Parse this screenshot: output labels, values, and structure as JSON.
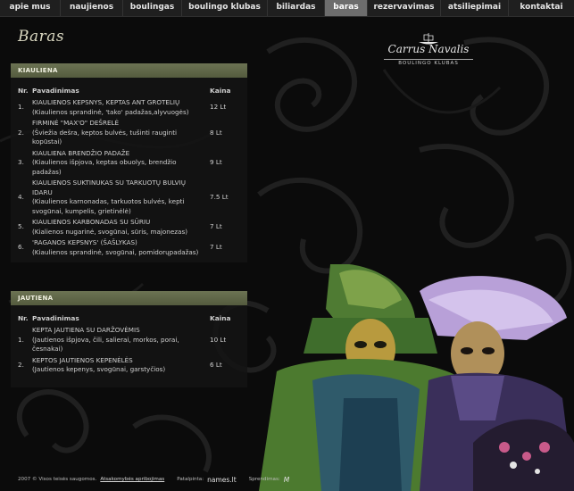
{
  "nav": {
    "items": [
      {
        "label": "apie mus",
        "active": false
      },
      {
        "label": "naujienos",
        "active": false
      },
      {
        "label": "boulingas",
        "active": false
      },
      {
        "label": "boulingo klubas",
        "active": false
      },
      {
        "label": "biliardas",
        "active": false
      },
      {
        "label": "baras",
        "active": true
      },
      {
        "label": "rezervavimas",
        "active": false
      },
      {
        "label": "atsiliepimai",
        "active": false
      },
      {
        "label": "kontaktai",
        "active": false
      }
    ]
  },
  "page": {
    "title": "Baras"
  },
  "logo": {
    "name": "Carrus Navalis",
    "subtitle": "BOULINGO KLUBAS"
  },
  "sections": [
    {
      "heading": "KIAULIENA",
      "headers": {
        "nr": "Nr.",
        "name": "Pavadinimas",
        "price": "Kaina"
      },
      "items": [
        {
          "nr": "1.",
          "name": "KIAULIENOS KEPSNYS, KEPTAS ANT GROTELIŲ",
          "desc": "(Kiaulienos sprandinė, 'tako' padažas,alyvuogės)",
          "price": "12 Lt"
        },
        {
          "nr": "2.",
          "name": "FIRMINĖ \"MAX'o\" DEŠRELĖ",
          "desc": "(Šviežia dešra, keptos bulvės, tušinti rauginti kopūstai)",
          "price": "8 Lt"
        },
        {
          "nr": "3.",
          "name": "KIAULIENA BRENDŽIO PADAŽE",
          "desc": "(Kiaulienos išpjova, keptas obuolys, brendžio padažas)",
          "price": "9 Lt"
        },
        {
          "nr": "4.",
          "name": "KIAULIENOS SUKTINUKAS SU TARKUOTŲ BULVIŲ IDARU",
          "desc": "(Kiaulienos karnonadas, tarkuotos bulvės, kepti svogūnai, kumpelis, grietinėlė)",
          "price": "7.5 Lt"
        },
        {
          "nr": "5.",
          "name": "KIAULIENOS KARBONADAS SU SŪRIU",
          "desc": "(Kialienos nugarinė, svogūnai, sūris, majonezas)",
          "price": "7 Lt"
        },
        {
          "nr": "6.",
          "name": "'RAGANOS KEPSNYS' (ŠAŠLYKAS)",
          "desc": "(Kiaulienos sprandinė, svogūnai, pomidorųpadažas)",
          "price": "7 Lt"
        }
      ]
    },
    {
      "heading": "JAUTIENA",
      "headers": {
        "nr": "Nr.",
        "name": "Pavadinimas",
        "price": "Kaina"
      },
      "items": [
        {
          "nr": "1.",
          "name": "KEPTA JAUTIENA SU DARŽOVĖMIS",
          "desc": "(Jautienos išpjova, čili, salierai, morkos, porai, česnakai)",
          "price": "10 Lt"
        },
        {
          "nr": "2.",
          "name": "KEPTOS JAUTIENOS KEPENĖLĖS",
          "desc": "(Jautienos kepenys, svogūnai, garstyčios)",
          "price": "6 Lt"
        }
      ]
    }
  ],
  "footer": {
    "copyright": "2007 © Visos teisės saugomos.",
    "link": "Atsakomybės apribojimas",
    "hosting_label": "Patalpinta:",
    "hosting_brand": "names.lt",
    "made_label": "Sprendimas:",
    "made_brand": "M"
  },
  "colors": {
    "background": "#0b0b0b",
    "nav_bg": "#1f1f1f",
    "nav_active": "#6d6d6d",
    "panel_head": "#5f6647",
    "text": "#d0d0d0"
  }
}
